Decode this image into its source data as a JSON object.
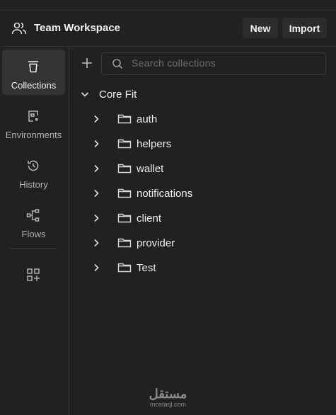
{
  "header": {
    "workspace_title": "Team Workspace",
    "new_label": "New",
    "import_label": "Import"
  },
  "sidebar": {
    "items": [
      {
        "label": "Collections",
        "icon": "trash-bin-icon",
        "active": true
      },
      {
        "label": "Environments",
        "icon": "environment-icon",
        "active": false
      },
      {
        "label": "History",
        "icon": "history-icon",
        "active": false
      },
      {
        "label": "Flows",
        "icon": "flows-icon",
        "active": false
      }
    ],
    "add_icon": "add-widget-icon"
  },
  "search": {
    "placeholder": "Search collections"
  },
  "collection": {
    "name": "Core Fit",
    "folders": [
      "auth",
      "helpers",
      "wallet",
      "notifications",
      "client",
      "provider",
      "Test"
    ]
  },
  "watermark": {
    "arabic": "مستقل",
    "latin": "mostaql.com"
  },
  "colors": {
    "background": "#212121",
    "active_nav": "#333333",
    "button_bg": "#2c2c2c",
    "text": "#f0f0f0",
    "muted_text": "#b0b0b0"
  }
}
